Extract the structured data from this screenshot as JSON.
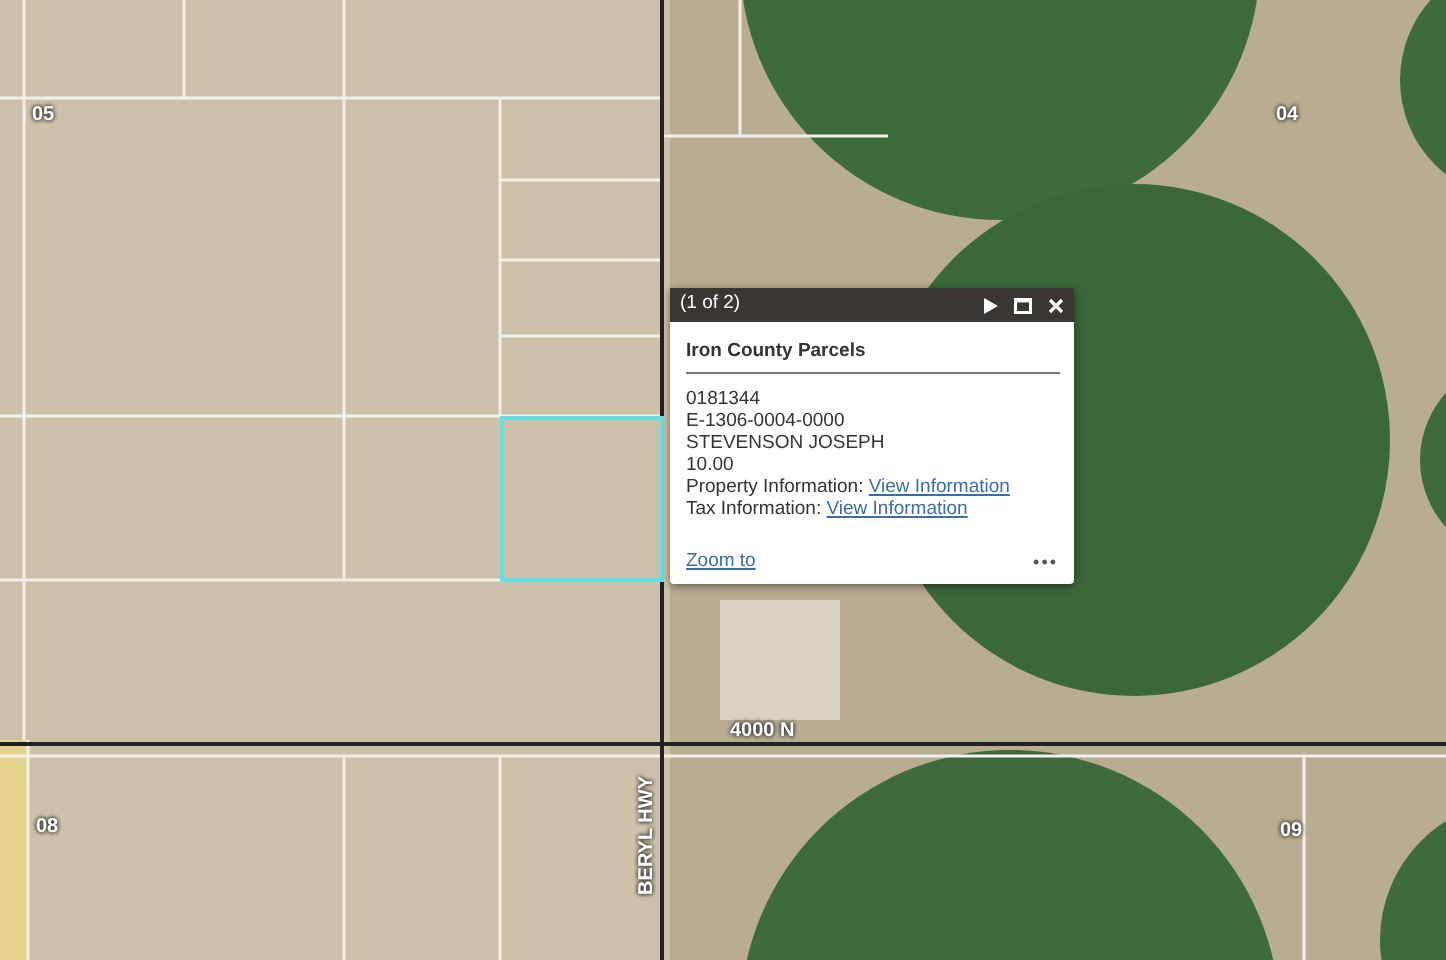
{
  "map": {
    "labels": [
      {
        "kind": "section",
        "text": "05"
      },
      {
        "kind": "section",
        "text": "04"
      },
      {
        "kind": "section",
        "text": "08"
      },
      {
        "kind": "section",
        "text": "09"
      },
      {
        "kind": "road",
        "text": "4000 N"
      },
      {
        "kind": "road-vertical",
        "text": "BERYL HWY"
      }
    ],
    "selected_parcel": true
  },
  "popup": {
    "counter": "(1 of 2)",
    "layer_title": "Iron County Parcels",
    "fields": [
      {
        "kind": "text",
        "text": "0181344"
      },
      {
        "kind": "text",
        "text": "E-1306-0004-0000"
      },
      {
        "kind": "text",
        "text": "STEVENSON JOSEPH"
      },
      {
        "kind": "text",
        "text": "10.00"
      },
      {
        "kind": "link",
        "label": "Property Information:",
        "link": "View Information"
      },
      {
        "kind": "link",
        "label": "Tax Information:",
        "link": "View Information"
      }
    ],
    "zoom_link": "Zoom to",
    "menu": "•••"
  }
}
